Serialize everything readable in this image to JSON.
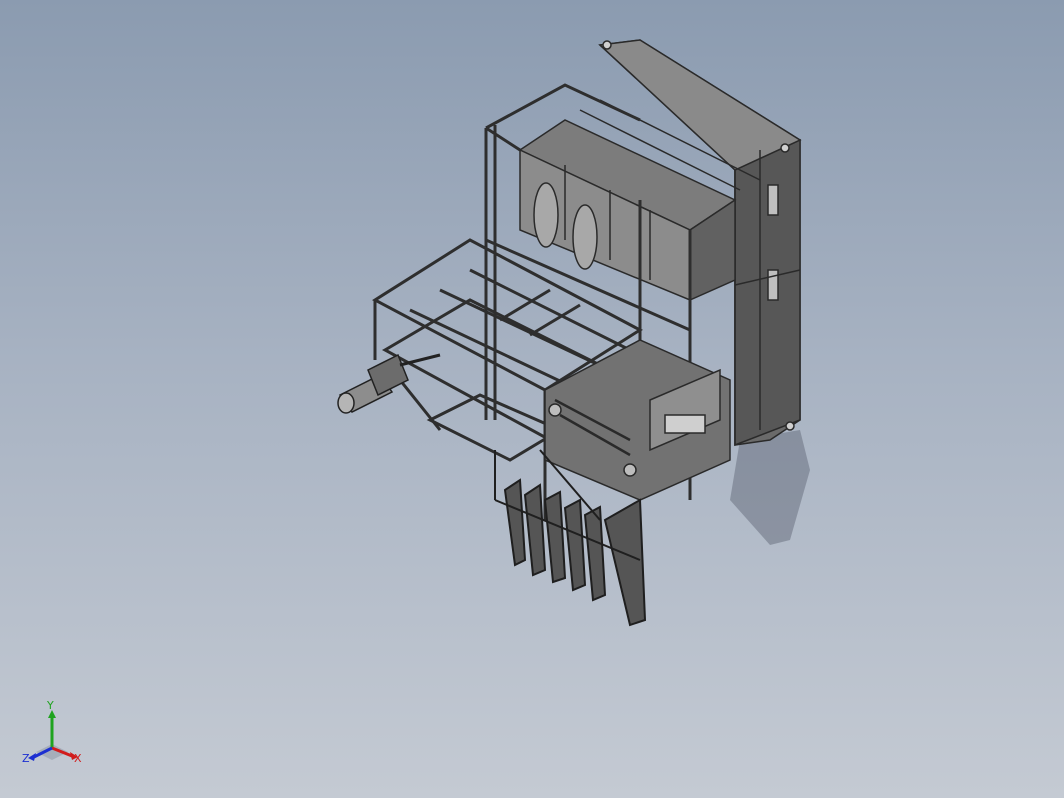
{
  "viewport": {
    "background_top": "#8b9bb0",
    "background_bottom": "#c4cad3"
  },
  "model": {
    "description_icon": "industrial-machine-assembly-icon",
    "frame_color": "#3f3f3f",
    "face_color": "#6e6e6e",
    "shadow_color": "#5b6270"
  },
  "triad": {
    "x_label": "X",
    "y_label": "Y",
    "z_label": "Z",
    "x_color": "#d11c1c",
    "y_color": "#1fa31f",
    "z_color": "#1c2fd1"
  }
}
